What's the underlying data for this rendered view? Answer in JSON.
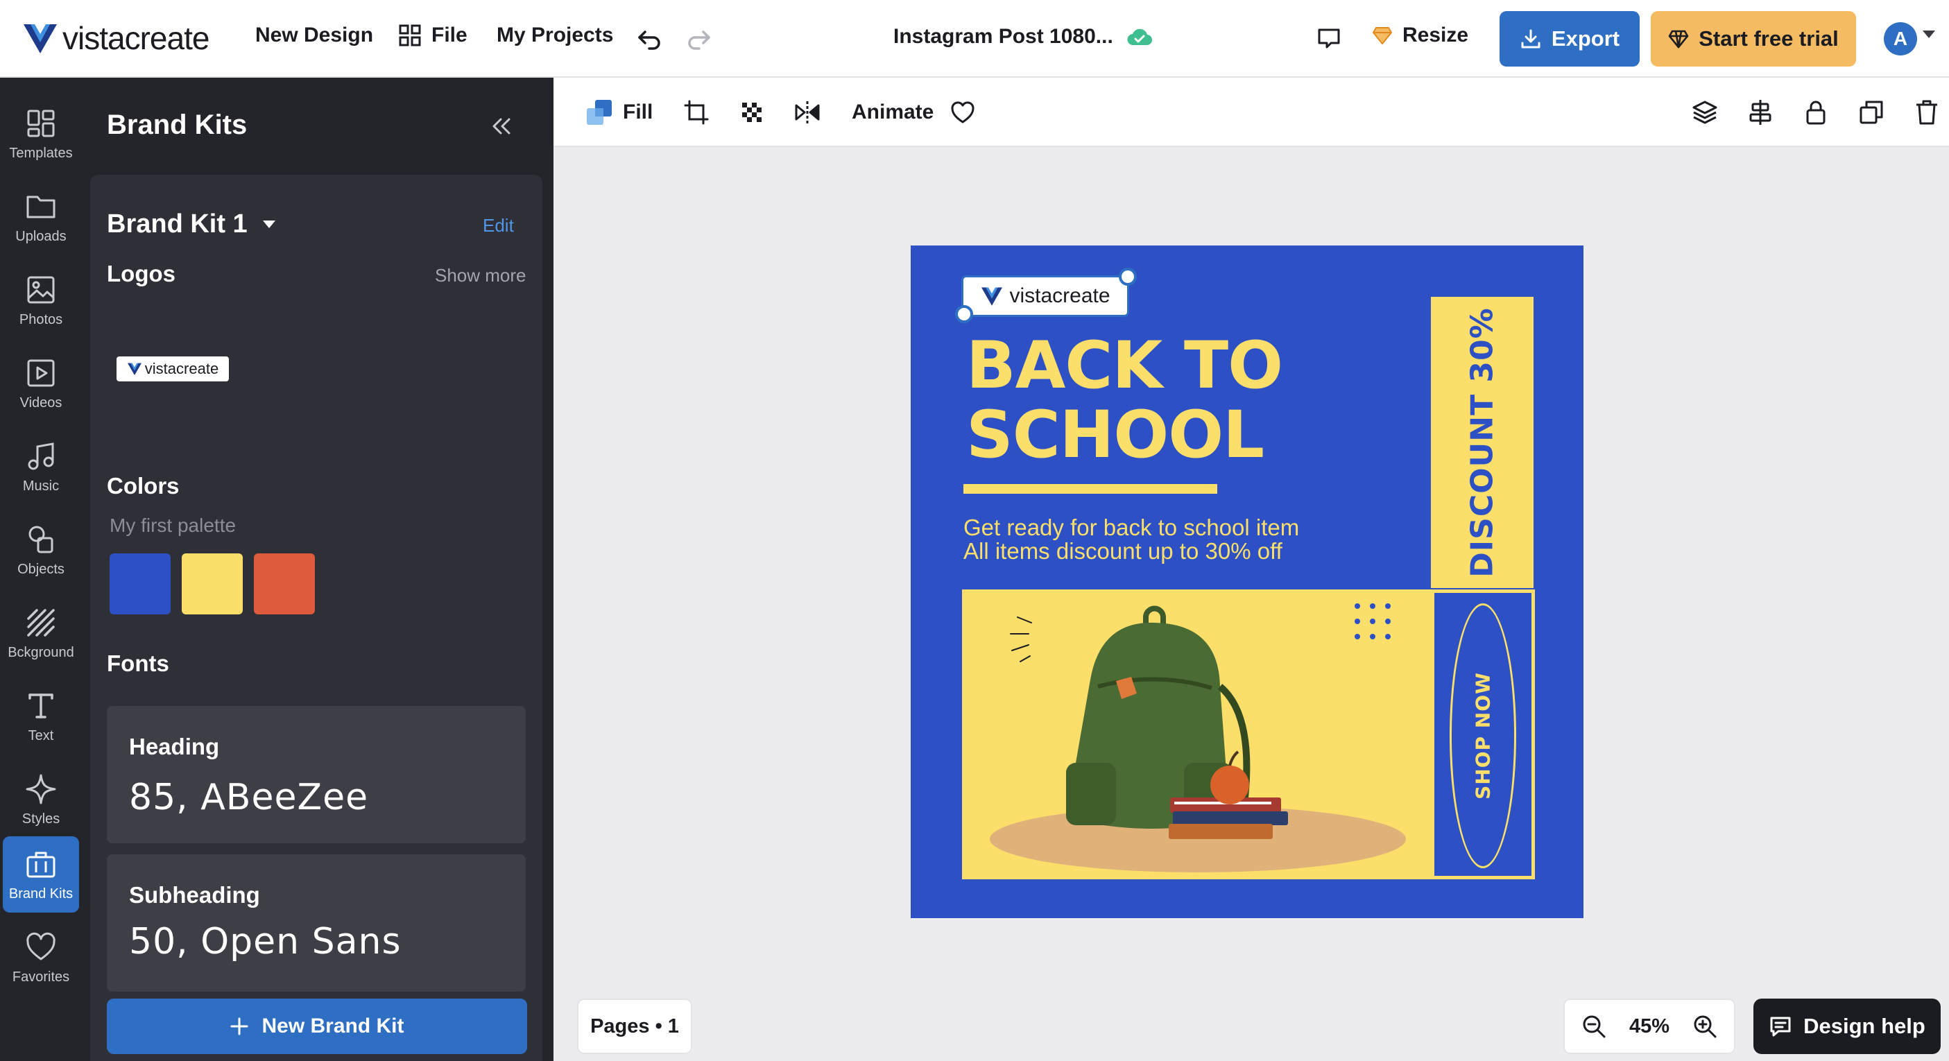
{
  "header": {
    "logo_text": "vistacreate",
    "new_design": "New Design",
    "file": "File",
    "my_projects": "My Projects",
    "doc_title": "Instagram Post 1080...",
    "resize": "Resize",
    "export": "Export",
    "start_trial": "Start free trial",
    "avatar_initial": "A"
  },
  "rail": {
    "templates": "Templates",
    "uploads": "Uploads",
    "photos": "Photos",
    "videos": "Videos",
    "music": "Music",
    "objects": "Objects",
    "background": "Bckground",
    "text": "Text",
    "styles": "Styles",
    "brand_kits": "Brand Kits",
    "favorites": "Favorites"
  },
  "panel": {
    "title": "Brand Kits",
    "kit_name": "Brand Kit 1",
    "edit": "Edit",
    "logos_title": "Logos",
    "show_more": "Show more",
    "logo_text": "vistacreate",
    "colors_title": "Colors",
    "palette_name": "My first palette",
    "swatches": [
      "#2d50c4",
      "#fbdf6a",
      "#de5a3d"
    ],
    "fonts_title": "Fonts",
    "heading_label": "Heading",
    "heading_value": "85, ABeeZee",
    "subheading_label": "Subheading",
    "subheading_value": "50, Open Sans",
    "new_kit": "New Brand Kit"
  },
  "toolbar": {
    "fill": "Fill",
    "animate": "Animate"
  },
  "artboard": {
    "logo_text": "vistacreate",
    "heading_line1": "BACK TO",
    "heading_line2": "SCHOOL",
    "sub_line1": "Get ready for back to school item",
    "sub_line2": "All items discount up to 30% off",
    "discount": "DISCOUNT 30%",
    "shop_now": "SHOP NOW",
    "bg_color": "#2d50c4",
    "accent_color": "#fbdf6a"
  },
  "footer": {
    "pages": "Pages • 1",
    "zoom": "45%",
    "design_help": "Design help"
  }
}
